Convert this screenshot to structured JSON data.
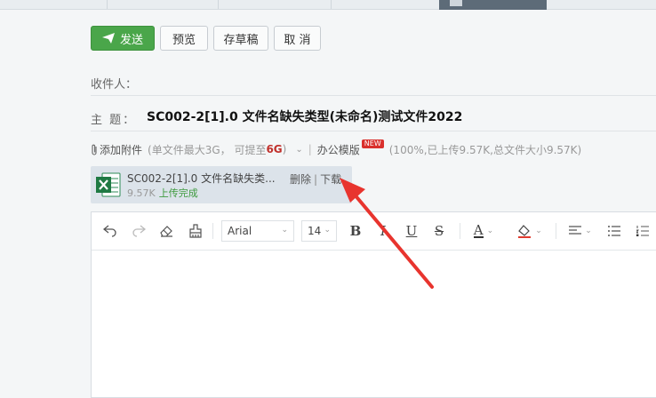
{
  "toolbar": {
    "send_label": "发送",
    "preview_label": "预览",
    "draft_label": "存草稿",
    "cancel_label": "取 消"
  },
  "compose": {
    "recipient_label": "收件人：",
    "subject_label": "主 题：",
    "subject_value": "SC002-2[1].0 文件名缺失类型(未命名)测试文件2022"
  },
  "attachments_bar": {
    "add_label": "添加附件",
    "limit_prefix": "(单文件最大3G， 可提至",
    "limit_value": "6G",
    "limit_suffix": ")",
    "office_templates_label": "办公模版",
    "new_badge": "NEW",
    "upload_status": "(100%,已上传9.57K,总文件大小9.57K)"
  },
  "attachment": {
    "file_name": "SC002-2[1].0 文件名缺失类...",
    "file_size": "9.57K",
    "status": "上传完成",
    "delete_label": "删除",
    "separator": "|",
    "download_label": "下载"
  },
  "editor_toolbar": {
    "font_family": "Arial",
    "font_size": "14",
    "bold_label": "B",
    "italic_label": "I",
    "underline_label": "U",
    "strike_label": "S",
    "font_color_label": "A"
  },
  "colors": {
    "send_green": "#4aa64a",
    "annotation_red": "#e8342e",
    "badge_red": "#d9302c",
    "excel_green": "#1f7a43"
  }
}
